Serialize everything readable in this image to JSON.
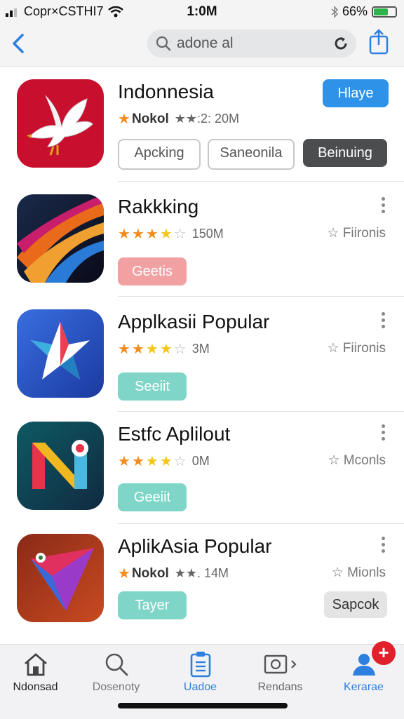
{
  "status_bar": {
    "carrier": "Copr×CSTHI7",
    "time": "1:0M",
    "battery_pct": "66%",
    "battery_level": 0.66
  },
  "nav": {
    "search_text": "adone al"
  },
  "apps": [
    {
      "title": "Indonnesia",
      "rating_prefix": "Nokol",
      "stars": 2,
      "count": "★★:2: 20M",
      "primary_button": "Hlaye",
      "chips": [
        "Apcking",
        "Saneonila",
        "Beinuing"
      ]
    },
    {
      "title": "Rakkking",
      "stars": 4,
      "count": "150M",
      "side_label": "☆ Fiironis",
      "button": "Geetis"
    },
    {
      "title": "Applkasii Popular",
      "stars": 4,
      "count": "3M",
      "side_label": "☆ Fiironis",
      "button": "Seeiit"
    },
    {
      "title": "Estfc Aplilout",
      "stars": 4,
      "count": "0M",
      "side_label": "☆ Mconls",
      "button": "Geeiit"
    },
    {
      "title": "AplikAsia Popular",
      "rating_prefix": "Nokol",
      "count": "★★. 14M",
      "side_label": "☆ Mionls",
      "button": "Tayer",
      "secondary_button": "Sapcok"
    }
  ],
  "tabs": [
    {
      "label": "Ndonsad",
      "icon": "home-icon"
    },
    {
      "label": "Dosenoty",
      "icon": "search-icon"
    },
    {
      "label": "Uadoe",
      "icon": "clipboard-icon",
      "active": true
    },
    {
      "label": "Rendans",
      "icon": "gallery-icon"
    },
    {
      "label": "Kerarae",
      "icon": "person-icon",
      "active": true
    }
  ],
  "badge": "+",
  "colors": {
    "accent_blue": "#2d7fe0",
    "primary_button": "#2d92e8",
    "dark_chip": "#4b4d4f",
    "pink_button": "#f2a1a3",
    "teal_button": "#7fd6c8",
    "badge_red": "#e0202b",
    "star_orange": "#f28c1e",
    "star_yellow": "#f5c518"
  }
}
